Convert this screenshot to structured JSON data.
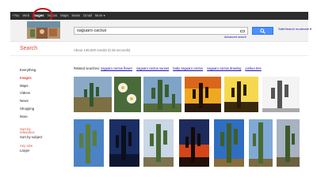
{
  "topbar": {
    "items": [
      "+You",
      "Web",
      "Images",
      "Videos",
      "Maps",
      "News",
      "Gmail",
      "More ▾"
    ],
    "active_index": 2
  },
  "search": {
    "query": "saguaro cactus",
    "advanced_link": "Advanced search",
    "safesearch": "SafeSearch moderate ▾"
  },
  "page": {
    "heading": "Search",
    "result_stats": "About 136,000 results (0.28 seconds)"
  },
  "sidebar": {
    "items": [
      "Everything",
      "Images",
      "Maps",
      "Videos",
      "News",
      "Shopping",
      "More"
    ],
    "active_index": 1,
    "sort_label_1": "Sort by",
    "sort_label_2": "relevance",
    "sort_subject": "Sort by subject",
    "size_label": "Any size",
    "size_larger": "Larger"
  },
  "related": {
    "label": "Related searches:",
    "links": [
      "saguaro cactus flower",
      "saguaro cactus sunset",
      "baby saguaro cactus",
      "saguaro cactus drawing",
      "joshua tree"
    ]
  },
  "colors": {
    "accent_red": "#dd4b39",
    "link_blue": "#1a0dab",
    "search_button": "#4d90fe",
    "topbar": "#2d2d2d"
  }
}
